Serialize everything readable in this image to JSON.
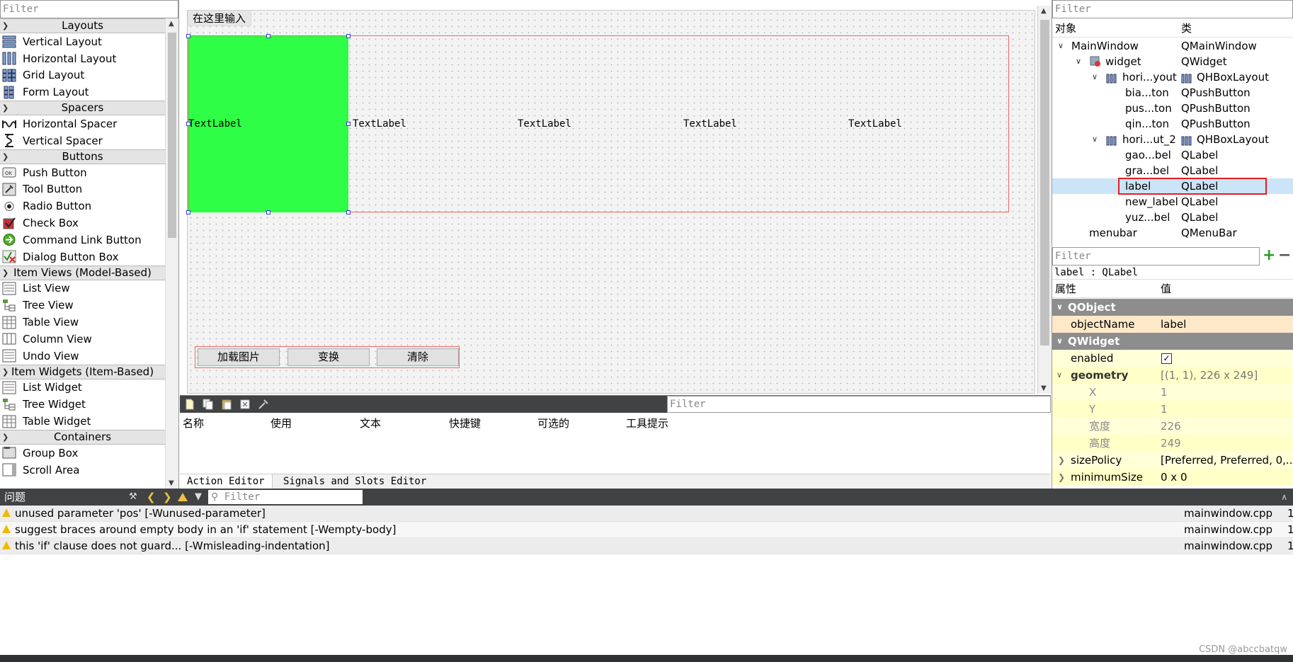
{
  "widget_box": {
    "filter_placeholder": "Filter",
    "categories": [
      {
        "title": "Layouts",
        "items": [
          "Vertical Layout",
          "Horizontal Layout",
          "Grid Layout",
          "Form Layout"
        ]
      },
      {
        "title": "Spacers",
        "items": [
          "Horizontal Spacer",
          "Vertical Spacer"
        ]
      },
      {
        "title": "Buttons",
        "items": [
          "Push Button",
          "Tool Button",
          "Radio Button",
          "Check Box",
          "Command Link Button",
          "Dialog Button Box"
        ]
      },
      {
        "title": "Item Views (Model-Based)",
        "items": [
          "List View",
          "Tree View",
          "Table View",
          "Column View",
          "Undo View"
        ]
      },
      {
        "title": "Item Widgets (Item-Based)",
        "items": [
          "List Widget",
          "Tree Widget",
          "Table Widget"
        ]
      },
      {
        "title": "Containers",
        "items": [
          "Group Box",
          "Scroll Area"
        ]
      }
    ]
  },
  "design": {
    "menu_hint": "在这里输入",
    "labels": [
      "TextLabel",
      "TextLabel",
      "TextLabel",
      "TextLabel",
      "TextLabel"
    ],
    "selected_label_color": "#2efe45",
    "buttons": [
      "加载图片",
      "变换",
      "清除"
    ]
  },
  "action_editor": {
    "filter_placeholder": "Filter",
    "columns": [
      "名称",
      "使用",
      "文本",
      "快捷键",
      "可选的",
      "工具提示"
    ],
    "tabs": [
      "Action Editor",
      "Signals and Slots Editor"
    ]
  },
  "object_inspector": {
    "filter_placeholder": "Filter",
    "col_object": "对象",
    "col_class": "类",
    "rows": [
      {
        "name": "MainWindow",
        "class": "QMainWindow"
      },
      {
        "name": "widget",
        "class": "QWidget"
      },
      {
        "name": "hori...yout",
        "class": "QHBoxLayout"
      },
      {
        "name": "bia...ton",
        "class": "QPushButton"
      },
      {
        "name": "pus...ton",
        "class": "QPushButton"
      },
      {
        "name": "qin...ton",
        "class": "QPushButton"
      },
      {
        "name": "hori...ut_2",
        "class": "QHBoxLayout"
      },
      {
        "name": "gao...bel",
        "class": "QLabel"
      },
      {
        "name": "gra...bel",
        "class": "QLabel"
      },
      {
        "name": "label",
        "class": "QLabel"
      },
      {
        "name": "new_label",
        "class": "QLabel"
      },
      {
        "name": "yuz...bel",
        "class": "QLabel"
      },
      {
        "name": "menubar",
        "class": "QMenuBar"
      }
    ]
  },
  "property_editor": {
    "filter_placeholder": "Filter",
    "object_title": "label : QLabel",
    "col_property": "属性",
    "col_value": "值",
    "rows": [
      {
        "name": "QObject",
        "value": ""
      },
      {
        "name": "objectName",
        "value": "label"
      },
      {
        "name": "QWidget",
        "value": ""
      },
      {
        "name": "enabled",
        "value": ""
      },
      {
        "name": "geometry",
        "value": "[(1, 1), 226 x 249]"
      },
      {
        "name": "X",
        "value": "1"
      },
      {
        "name": "Y",
        "value": "1"
      },
      {
        "name": "宽度",
        "value": "226"
      },
      {
        "name": "高度",
        "value": "249"
      },
      {
        "name": "sizePolicy",
        "value": "[Preferred, Preferred, 0,..."
      },
      {
        "name": "minimumSize",
        "value": "0 x 0"
      }
    ]
  },
  "issues": {
    "title": "问题",
    "filter_placeholder": "Filter",
    "rows": [
      {
        "message": "unused parameter 'pos' [-Wunused-parameter]",
        "file": "mainwindow.cpp",
        "line": "1"
      },
      {
        "message": "suggest braces around empty body in an 'if' statement [-Wempty-body]",
        "file": "mainwindow.cpp",
        "line": "1"
      },
      {
        "message": "this 'if' clause does not guard... [-Wmisleading-indentation]",
        "file": "mainwindow.cpp",
        "line": "1"
      }
    ]
  },
  "watermark": "CSDN @abccbatqw"
}
